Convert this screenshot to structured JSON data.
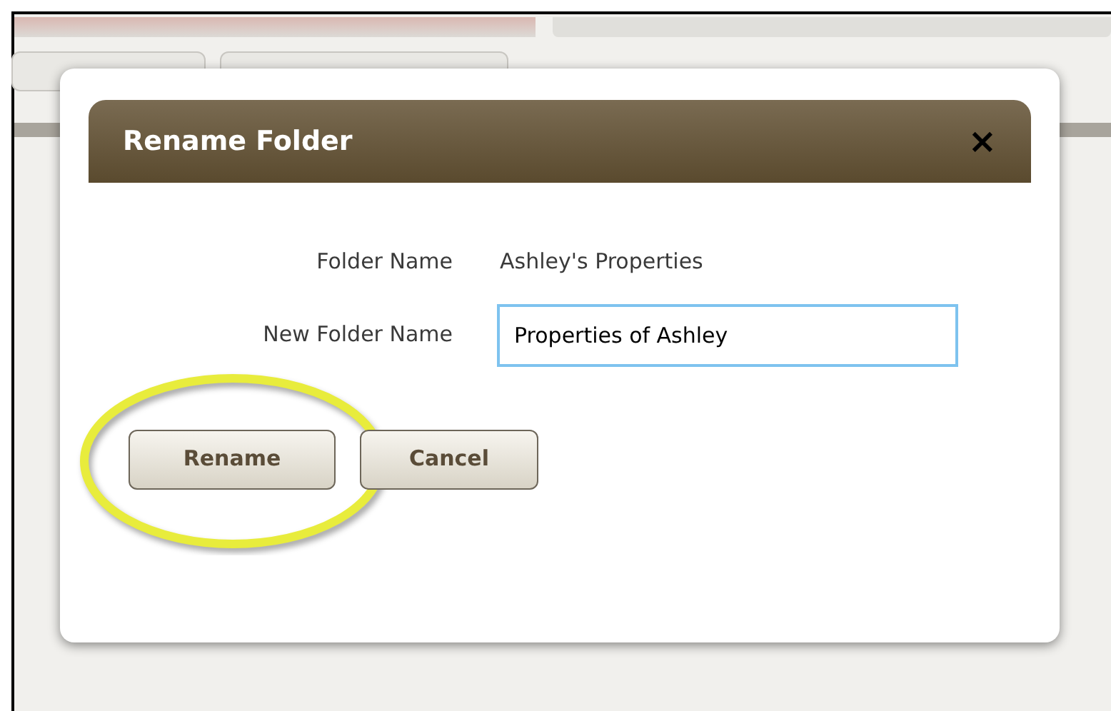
{
  "dialog": {
    "title": "Rename Folder",
    "close": "×",
    "fields": [
      {
        "kind": "text",
        "label": "Folder Name",
        "value": "Ashley's Properties"
      },
      {
        "kind": "input",
        "label": "New Folder Name",
        "value": "Properties of Ashley"
      }
    ],
    "buttons": [
      {
        "label": "Rename",
        "highlighted": true
      },
      {
        "label": "Cancel",
        "highlighted": false
      }
    ]
  }
}
